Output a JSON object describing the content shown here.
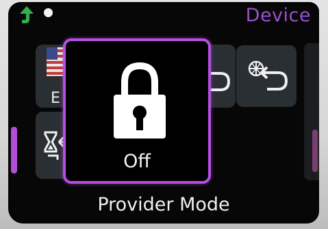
{
  "header": {
    "title": "Device",
    "back_icon": "back-arrow-icon",
    "status_indicator": "status-dot"
  },
  "tiles": [
    {
      "name": "language",
      "icon": "flag-icon",
      "label": "E"
    },
    {
      "name": "timer",
      "icon": "timer-icon"
    },
    {
      "name": "mid",
      "icon": "return-arrow-icon"
    },
    {
      "name": "reset",
      "icon": "reset-icon"
    }
  ],
  "popup": {
    "icon": "lock-icon",
    "state_label": "Off"
  },
  "footer": {
    "mode_label": "Provider Mode"
  },
  "colors": {
    "accent": "#b44fe0",
    "header_text": "#9b4fd0",
    "back_arrow": "#2fb04a",
    "tile_bg": "#2a2f33",
    "screen_bg": "#070707"
  }
}
